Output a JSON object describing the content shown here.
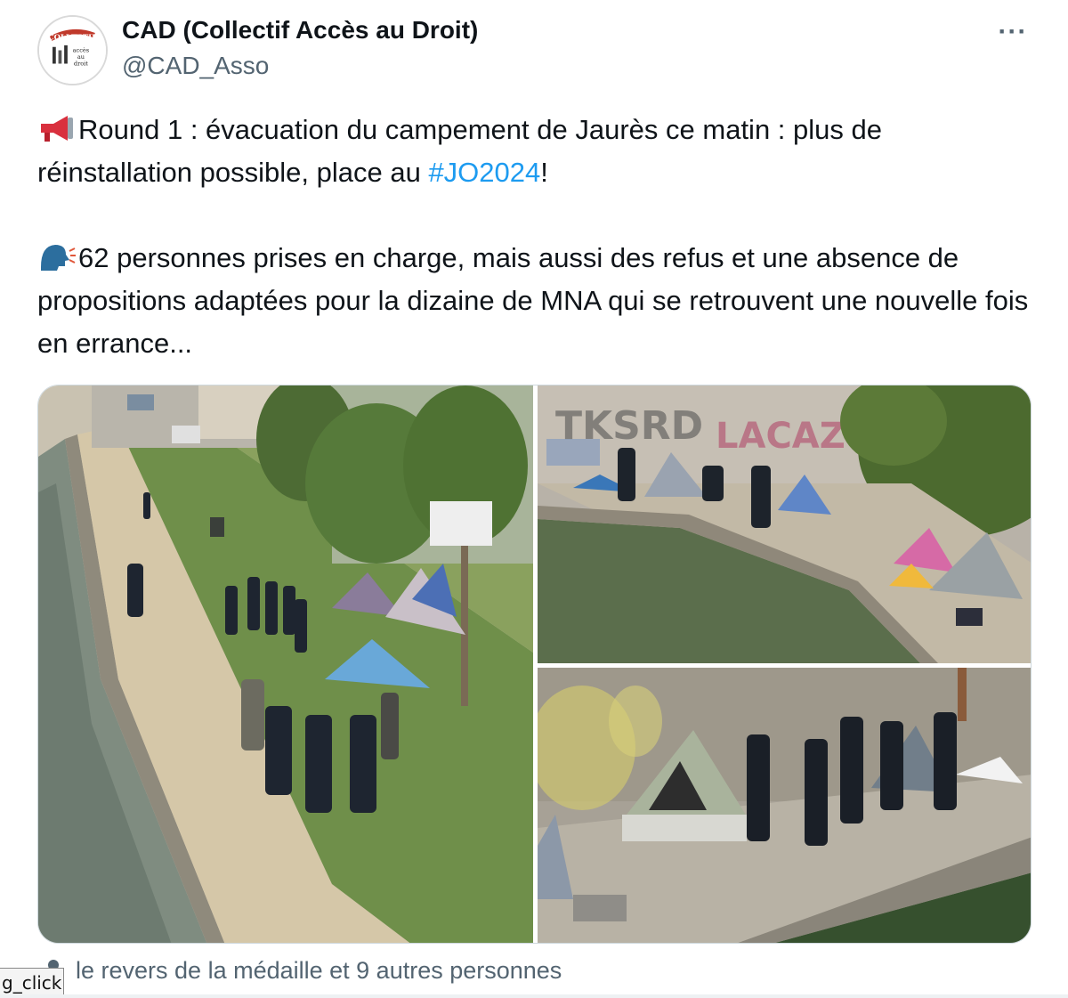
{
  "author": {
    "display_name": "CAD (Collectif Accès au Droit)",
    "handle": "@CAD_Asso",
    "avatar_text": "COLLECTIF ACCÈS AU DROIT"
  },
  "menu": {
    "more_label": "···"
  },
  "tweet": {
    "line1_before": "Round 1 : évacuation du campement de Jaurès ce matin : plus de réinstallation possible, place au ",
    "hashtag": "#JO2024",
    "line1_after": "!",
    "line2": "62 personnes prises en charge, mais aussi des refus et une absence de propositions adaptées pour la dizaine de MNA qui se retrouvent une nouvelle fois en errance...",
    "emoji1": "megaphone-icon",
    "emoji2": "speaking-head-icon"
  },
  "media": {
    "photos": [
      {
        "name": "photo-canal-path-police"
      },
      {
        "name": "photo-tents-graffiti-wall"
      },
      {
        "name": "photo-police-line-tents"
      }
    ]
  },
  "tagged": {
    "text": "le revers de la médaille et 9 autres personnes",
    "icon": "person-icon"
  },
  "overlay": {
    "debug_label": "g_click"
  },
  "colors": {
    "link": "#1d9bf0",
    "secondary_text": "#536471",
    "primary_text": "#0f1419"
  }
}
